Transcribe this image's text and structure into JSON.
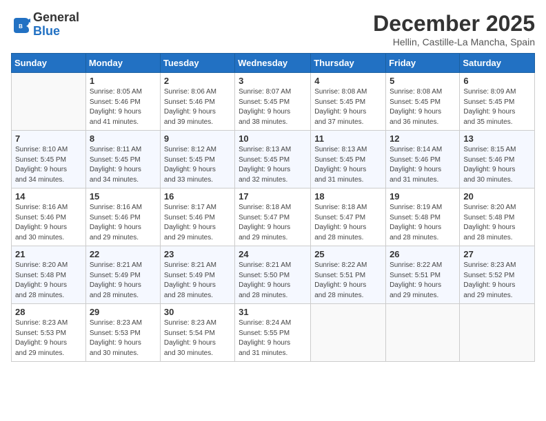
{
  "logo": {
    "line1": "General",
    "line2": "Blue"
  },
  "title": "December 2025",
  "location": "Hellin, Castille-La Mancha, Spain",
  "days_of_week": [
    "Sunday",
    "Monday",
    "Tuesday",
    "Wednesday",
    "Thursday",
    "Friday",
    "Saturday"
  ],
  "weeks": [
    [
      {
        "day": "",
        "info": ""
      },
      {
        "day": "1",
        "info": "Sunrise: 8:05 AM\nSunset: 5:46 PM\nDaylight: 9 hours\nand 41 minutes."
      },
      {
        "day": "2",
        "info": "Sunrise: 8:06 AM\nSunset: 5:46 PM\nDaylight: 9 hours\nand 39 minutes."
      },
      {
        "day": "3",
        "info": "Sunrise: 8:07 AM\nSunset: 5:45 PM\nDaylight: 9 hours\nand 38 minutes."
      },
      {
        "day": "4",
        "info": "Sunrise: 8:08 AM\nSunset: 5:45 PM\nDaylight: 9 hours\nand 37 minutes."
      },
      {
        "day": "5",
        "info": "Sunrise: 8:08 AM\nSunset: 5:45 PM\nDaylight: 9 hours\nand 36 minutes."
      },
      {
        "day": "6",
        "info": "Sunrise: 8:09 AM\nSunset: 5:45 PM\nDaylight: 9 hours\nand 35 minutes."
      }
    ],
    [
      {
        "day": "7",
        "info": "Sunrise: 8:10 AM\nSunset: 5:45 PM\nDaylight: 9 hours\nand 34 minutes."
      },
      {
        "day": "8",
        "info": "Sunrise: 8:11 AM\nSunset: 5:45 PM\nDaylight: 9 hours\nand 34 minutes."
      },
      {
        "day": "9",
        "info": "Sunrise: 8:12 AM\nSunset: 5:45 PM\nDaylight: 9 hours\nand 33 minutes."
      },
      {
        "day": "10",
        "info": "Sunrise: 8:13 AM\nSunset: 5:45 PM\nDaylight: 9 hours\nand 32 minutes."
      },
      {
        "day": "11",
        "info": "Sunrise: 8:13 AM\nSunset: 5:45 PM\nDaylight: 9 hours\nand 31 minutes."
      },
      {
        "day": "12",
        "info": "Sunrise: 8:14 AM\nSunset: 5:46 PM\nDaylight: 9 hours\nand 31 minutes."
      },
      {
        "day": "13",
        "info": "Sunrise: 8:15 AM\nSunset: 5:46 PM\nDaylight: 9 hours\nand 30 minutes."
      }
    ],
    [
      {
        "day": "14",
        "info": "Sunrise: 8:16 AM\nSunset: 5:46 PM\nDaylight: 9 hours\nand 30 minutes."
      },
      {
        "day": "15",
        "info": "Sunrise: 8:16 AM\nSunset: 5:46 PM\nDaylight: 9 hours\nand 29 minutes."
      },
      {
        "day": "16",
        "info": "Sunrise: 8:17 AM\nSunset: 5:46 PM\nDaylight: 9 hours\nand 29 minutes."
      },
      {
        "day": "17",
        "info": "Sunrise: 8:18 AM\nSunset: 5:47 PM\nDaylight: 9 hours\nand 29 minutes."
      },
      {
        "day": "18",
        "info": "Sunrise: 8:18 AM\nSunset: 5:47 PM\nDaylight: 9 hours\nand 28 minutes."
      },
      {
        "day": "19",
        "info": "Sunrise: 8:19 AM\nSunset: 5:48 PM\nDaylight: 9 hours\nand 28 minutes."
      },
      {
        "day": "20",
        "info": "Sunrise: 8:20 AM\nSunset: 5:48 PM\nDaylight: 9 hours\nand 28 minutes."
      }
    ],
    [
      {
        "day": "21",
        "info": "Sunrise: 8:20 AM\nSunset: 5:48 PM\nDaylight: 9 hours\nand 28 minutes."
      },
      {
        "day": "22",
        "info": "Sunrise: 8:21 AM\nSunset: 5:49 PM\nDaylight: 9 hours\nand 28 minutes."
      },
      {
        "day": "23",
        "info": "Sunrise: 8:21 AM\nSunset: 5:49 PM\nDaylight: 9 hours\nand 28 minutes."
      },
      {
        "day": "24",
        "info": "Sunrise: 8:21 AM\nSunset: 5:50 PM\nDaylight: 9 hours\nand 28 minutes."
      },
      {
        "day": "25",
        "info": "Sunrise: 8:22 AM\nSunset: 5:51 PM\nDaylight: 9 hours\nand 28 minutes."
      },
      {
        "day": "26",
        "info": "Sunrise: 8:22 AM\nSunset: 5:51 PM\nDaylight: 9 hours\nand 29 minutes."
      },
      {
        "day": "27",
        "info": "Sunrise: 8:23 AM\nSunset: 5:52 PM\nDaylight: 9 hours\nand 29 minutes."
      }
    ],
    [
      {
        "day": "28",
        "info": "Sunrise: 8:23 AM\nSunset: 5:53 PM\nDaylight: 9 hours\nand 29 minutes."
      },
      {
        "day": "29",
        "info": "Sunrise: 8:23 AM\nSunset: 5:53 PM\nDaylight: 9 hours\nand 30 minutes."
      },
      {
        "day": "30",
        "info": "Sunrise: 8:23 AM\nSunset: 5:54 PM\nDaylight: 9 hours\nand 30 minutes."
      },
      {
        "day": "31",
        "info": "Sunrise: 8:24 AM\nSunset: 5:55 PM\nDaylight: 9 hours\nand 31 minutes."
      },
      {
        "day": "",
        "info": ""
      },
      {
        "day": "",
        "info": ""
      },
      {
        "day": "",
        "info": ""
      }
    ]
  ]
}
